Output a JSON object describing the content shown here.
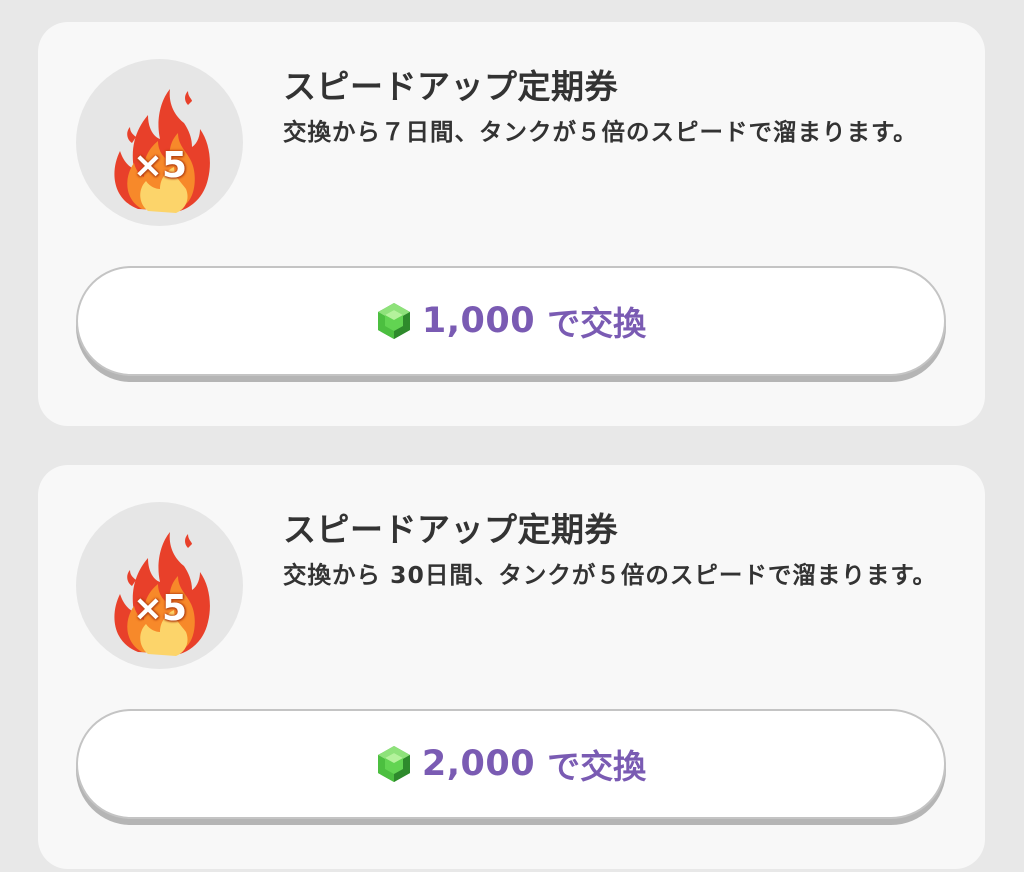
{
  "items": [
    {
      "title": "スピードアップ定期券",
      "description": "交換から７日間、タンクが５倍のスピードで溜まります。",
      "multiplier": "×5",
      "icon": "fire-x5-icon",
      "button": {
        "price": "1,000",
        "suffix": "で交換",
        "currency_icon": "green-gem-icon"
      }
    },
    {
      "title": "スピードアップ定期券",
      "description": "交換から 30日間、タンクが５倍のスピードで溜まります。",
      "multiplier": "×5",
      "icon": "fire-x5-icon",
      "button": {
        "price": "2,000",
        "suffix": "で交換",
        "currency_icon": "green-gem-icon"
      }
    }
  ],
  "colors": {
    "background": "#e8e8e8",
    "card": "#f8f8f8",
    "accent_purple": "#7a5bb3",
    "gem_green": "#5cc44c",
    "text": "#333333"
  }
}
